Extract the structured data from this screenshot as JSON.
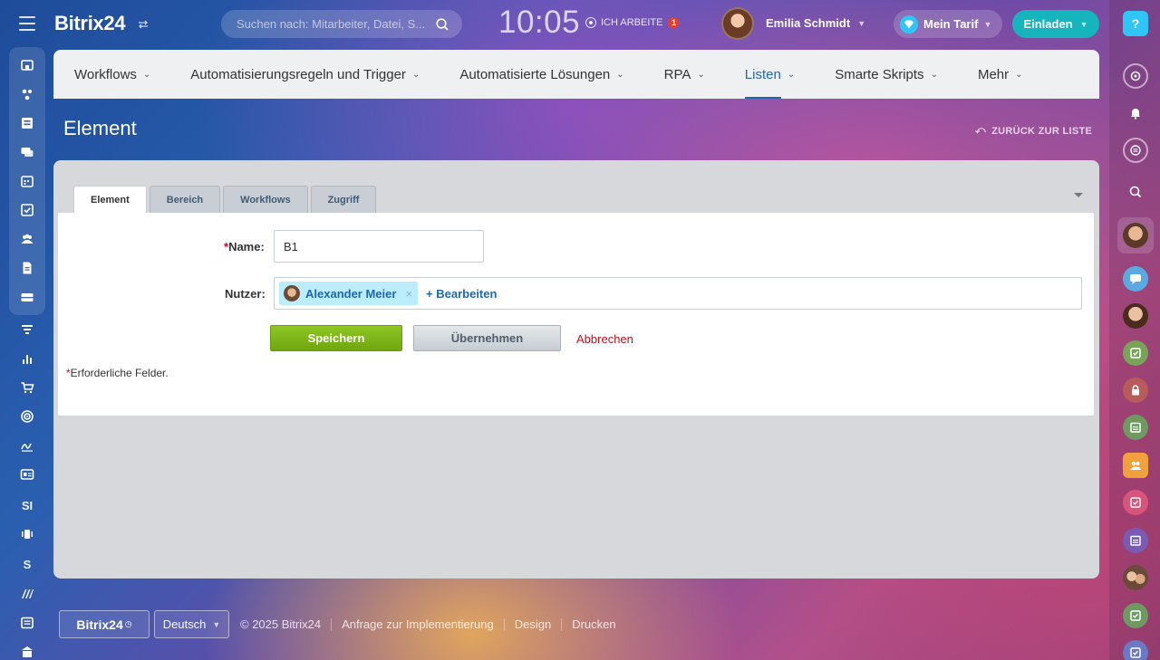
{
  "header": {
    "logo": "Bitrix24",
    "search_placeholder": "Suchen nach: Mitarbeiter, Datei, S...",
    "clock": "10:05",
    "work_status": "ICH ARBEITE",
    "work_badge": "1",
    "user_name": "Emilia Schmidt",
    "tariff": "Mein Tarif",
    "invite": "Einladen",
    "help": "?"
  },
  "left_sidebar": {
    "text_items": [
      "SI",
      "S"
    ]
  },
  "nav": {
    "items": [
      {
        "label": "Workflows"
      },
      {
        "label": "Automatisierungsregeln und Trigger"
      },
      {
        "label": "Automatisierte Lösungen"
      },
      {
        "label": "RPA"
      },
      {
        "label": "Listen"
      },
      {
        "label": "Smarte Skripts"
      },
      {
        "label": "Mehr"
      }
    ],
    "active": "Listen"
  },
  "page": {
    "title": "Element",
    "back_link": "ZURÜCK ZUR LISTE"
  },
  "tabs": [
    {
      "label": "Element",
      "active": true
    },
    {
      "label": "Bereich",
      "active": false
    },
    {
      "label": "Workflows",
      "active": false
    },
    {
      "label": "Zugriff",
      "active": false
    }
  ],
  "form": {
    "required_mark": "*",
    "name_label": "Name:",
    "name_value": "B1",
    "users_label": "Nutzer:",
    "user_chip": "Alexander Meier",
    "chip_remove": "×",
    "edit_link": "+ Bearbeiten",
    "save": "Speichern",
    "apply": "Übernehmen",
    "cancel": "Abbrechen",
    "required_note": "Erforderliche Felder."
  },
  "footer": {
    "logo": "Bitrix24",
    "language": "Deutsch",
    "copyright": "© 2025 Bitrix24",
    "links": [
      "Anfrage zur Implementierung",
      "Design",
      "Drucken"
    ]
  },
  "colors": {
    "accent": "#2067b0",
    "save_green": "#7ab51d",
    "invite_teal": "#16b4bd",
    "cancel_red": "#c2131d"
  }
}
